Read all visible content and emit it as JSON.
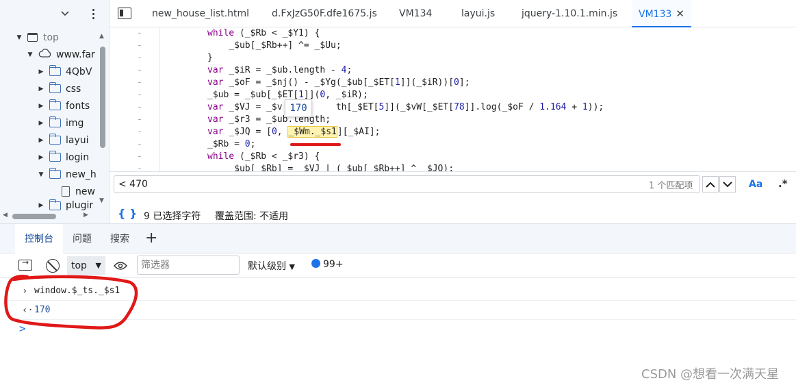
{
  "tabs": [
    {
      "label": "new_house_list.html"
    },
    {
      "label": "d.FxJzG50F.dfe1675.js"
    },
    {
      "label": "VM134"
    },
    {
      "label": "layui.js"
    },
    {
      "label": "jquery-1.10.1.min.js"
    },
    {
      "label": "VM133"
    }
  ],
  "file_tree": {
    "top": "top",
    "domain": "www.far",
    "items": [
      "4QbV",
      "css",
      "fonts",
      "img",
      "layui",
      "login",
      "new_h",
      "new",
      "plugir"
    ]
  },
  "code": {
    "lines": [
      {
        "parts": [
          [
            "kw",
            "while"
          ],
          [
            "",
            " (_$Rb < _$Y1) {"
          ]
        ]
      },
      {
        "parts": [
          [
            "",
            "    _$ub[_$Rb++] ^= _$Uu;"
          ]
        ]
      },
      {
        "parts": [
          [
            "",
            "}"
          ]
        ]
      },
      {
        "parts": [
          [
            "kw",
            "var"
          ],
          [
            "",
            " _$iR = _$ub.length - "
          ],
          [
            "num",
            "4"
          ],
          [
            "",
            ";"
          ]
        ]
      },
      {
        "parts": [
          [
            "kw",
            "var"
          ],
          [
            "",
            " _$oF = _$nj() - _$Yg(_$ub[_$ET["
          ],
          [
            "num",
            "1"
          ],
          [
            "",
            "]](_$iR))["
          ],
          [
            "num",
            "0"
          ],
          [
            "",
            "];"
          ]
        ]
      },
      {
        "parts": [
          [
            "",
            "_$ub = _$ub[_$ET["
          ],
          [
            "num",
            "1"
          ],
          [
            "",
            "]]("
          ],
          [
            "num",
            "0"
          ],
          [
            "",
            ", _$iR);"
          ]
        ]
      },
      {
        "parts": [
          [
            "kw",
            "var"
          ],
          [
            "",
            " _$VJ = _$v"
          ],
          [
            "",
            "          "
          ],
          [
            "",
            "th[_$ET["
          ],
          [
            "num",
            "5"
          ],
          [
            "",
            "]](_$vW[_$ET["
          ],
          [
            "num",
            "78"
          ],
          [
            "",
            "]].log(_$oF / "
          ],
          [
            "num",
            "1.164"
          ],
          [
            "",
            " + "
          ],
          [
            "num",
            "1"
          ],
          [
            "",
            "));"
          ]
        ]
      },
      {
        "parts": [
          [
            "kw",
            "var"
          ],
          [
            "",
            " _$r3 = _$ub.length;"
          ]
        ]
      },
      {
        "parts": [
          [
            "kw",
            "var"
          ],
          [
            "",
            " _$JQ = ["
          ],
          [
            "num",
            "0"
          ],
          [
            "",
            ", "
          ],
          [
            "hl",
            "_$Wm._$s1"
          ],
          [
            "",
            "][_$AI];"
          ]
        ]
      },
      {
        "parts": [
          [
            "",
            "_$Rb = "
          ],
          [
            "num",
            "0"
          ],
          [
            "",
            ";"
          ]
        ]
      },
      {
        "parts": [
          [
            "kw",
            "while"
          ],
          [
            "",
            " (_$Rb < _$r3) {"
          ]
        ]
      },
      {
        "parts": [
          [
            "",
            "    _$ub[_$Rb] = _$VJ | (_$ub[_$Rb++] ^ _$JQ);"
          ]
        ]
      }
    ],
    "hover_value": "170"
  },
  "search": {
    "query": "< 470",
    "match_count": "1 个匹配项",
    "case_label": "Aa",
    "regex_label": ".*"
  },
  "status": {
    "braces": "{ }",
    "selected": "9 已选择字符",
    "coverage": "覆盖范围: 不适用"
  },
  "drawer": {
    "tabs": [
      "控制台",
      "问题",
      "搜索"
    ],
    "add": "+"
  },
  "console_toolbar": {
    "context": "top",
    "filter_placeholder": "筛选器",
    "level": "默认级别",
    "issues": "99+"
  },
  "console": {
    "input": "window.$_ts._$s1",
    "output": "170",
    "prompt": ">"
  },
  "watermark": "CSDN @想看一次满天星",
  "colors": {
    "accent": "#1a73e8",
    "annotation": "#e01818"
  }
}
